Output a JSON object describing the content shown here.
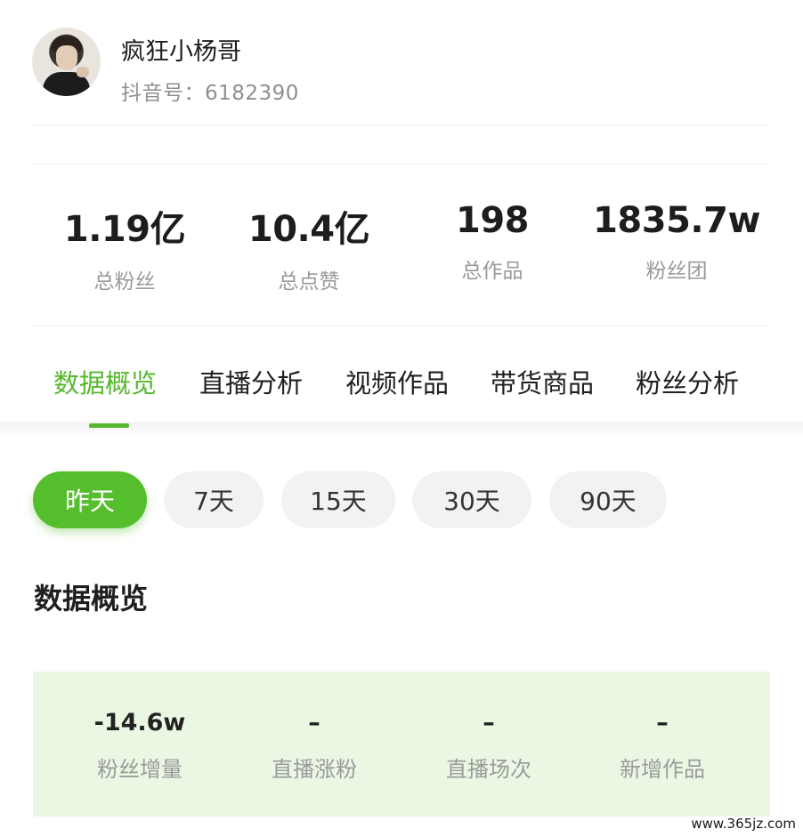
{
  "profile": {
    "nickname": "疯狂小杨哥",
    "account": "抖音号：6182390"
  },
  "stats": [
    {
      "value": "1.19亿",
      "label": "总粉丝"
    },
    {
      "value": "10.4亿",
      "label": "总点赞"
    },
    {
      "value": "198",
      "label": "总作品"
    },
    {
      "value": "1835.7w",
      "label": "粉丝团"
    }
  ],
  "tabs": [
    {
      "label": "数据概览",
      "active": true
    },
    {
      "label": "直播分析",
      "active": false
    },
    {
      "label": "视频作品",
      "active": false
    },
    {
      "label": "带货商品",
      "active": false
    },
    {
      "label": "粉丝分析",
      "active": false
    }
  ],
  "periods": [
    {
      "label": "昨天",
      "active": true
    },
    {
      "label": "7天",
      "active": false
    },
    {
      "label": "15天",
      "active": false
    },
    {
      "label": "30天",
      "active": false
    },
    {
      "label": "90天",
      "active": false
    }
  ],
  "section_title": "数据概览",
  "metrics": [
    {
      "value": "-14.6w",
      "label": "粉丝增量"
    },
    {
      "value": "–",
      "label": "直播涨粉"
    },
    {
      "value": "–",
      "label": "直播场次"
    },
    {
      "value": "–",
      "label": "新增作品"
    }
  ],
  "watermark": "www.365jz.com",
  "colors": {
    "accent": "#55b82c",
    "panel": "#eaf8e3"
  }
}
